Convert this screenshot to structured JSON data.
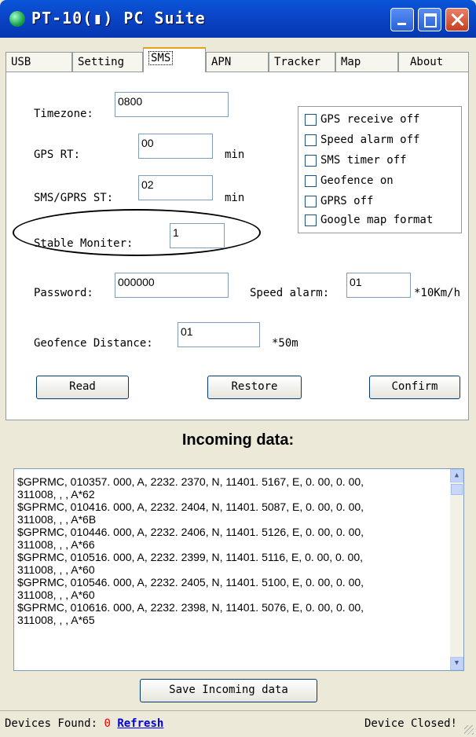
{
  "window": {
    "title": "PT-10(▮) PC Suite",
    "controls": [
      "minimize-icon",
      "maximize-icon",
      "close-icon"
    ]
  },
  "tabs": [
    {
      "label": "USB",
      "active": false
    },
    {
      "label": "Setting",
      "active": false
    },
    {
      "label": "SMS",
      "active": true
    },
    {
      "label": "APN",
      "active": false
    },
    {
      "label": "Tracker",
      "active": false
    },
    {
      "label": "Map",
      "active": false
    },
    {
      "label": "About",
      "active": false
    }
  ],
  "form": {
    "timezone": {
      "label": "Timezone:",
      "value": "0800"
    },
    "gps_rt": {
      "label": "GPS RT:",
      "value": "00",
      "unit": "min"
    },
    "sms_gprs_st": {
      "label": "SMS/GPRS ST:",
      "value": "02",
      "unit": "min"
    },
    "stable_moniter": {
      "label": "Stable Moniter:",
      "value": "1"
    },
    "password": {
      "label": "Password:",
      "value": "000000"
    },
    "speed_alarm": {
      "label": "Speed alarm:",
      "value": "01",
      "unit": "*10Km/h"
    },
    "geofence_distance": {
      "label": "Geofence Distance:",
      "value": "01",
      "unit": "*50m"
    }
  },
  "options": [
    {
      "label": "GPS receive off",
      "checked": false
    },
    {
      "label": "Speed alarm off",
      "checked": false
    },
    {
      "label": "SMS timer off",
      "checked": false
    },
    {
      "label": "Geofence on",
      "checked": false
    },
    {
      "label": "GPRS off",
      "checked": false
    },
    {
      "label": "Google map format",
      "checked": false
    }
  ],
  "buttons": {
    "read": "Read",
    "restore": "Restore",
    "confirm": "Confirm",
    "save_incoming": "Save Incoming data"
  },
  "incoming": {
    "title": "Incoming data:",
    "lines": [
      "$GPRMC, 010357. 000, A, 2232. 2370, N, 11401. 5167, E, 0. 00, 0. 00,",
      "311008, , , A*62",
      "$GPRMC, 010416. 000, A, 2232. 2404, N, 11401. 5087, E, 0. 00, 0. 00,",
      "311008, , , A*6B",
      "$GPRMC, 010446. 000, A, 2232. 2406, N, 11401. 5126, E, 0. 00, 0. 00,",
      "311008, , , A*66",
      "$GPRMC, 010516. 000, A, 2232. 2399, N, 11401. 5116, E, 0. 00, 0. 00,",
      "311008, , , A*60",
      "$GPRMC, 010546. 000, A, 2232. 2405, N, 11401. 5100, E, 0. 00, 0. 00,",
      "311008, , , A*60",
      "$GPRMC, 010616. 000, A, 2232. 2398, N, 11401. 5076, E, 0. 00, 0. 00,",
      "311008, , , A*65"
    ]
  },
  "status": {
    "devices_label": "Devices Found:",
    "count": "0",
    "refresh": "Refresh",
    "state": "Device Closed!"
  },
  "colors": {
    "titlebar": "#0a46c8",
    "accent_tab": "#e7a21a",
    "status_count": "#e00000",
    "link": "#0000e0"
  }
}
